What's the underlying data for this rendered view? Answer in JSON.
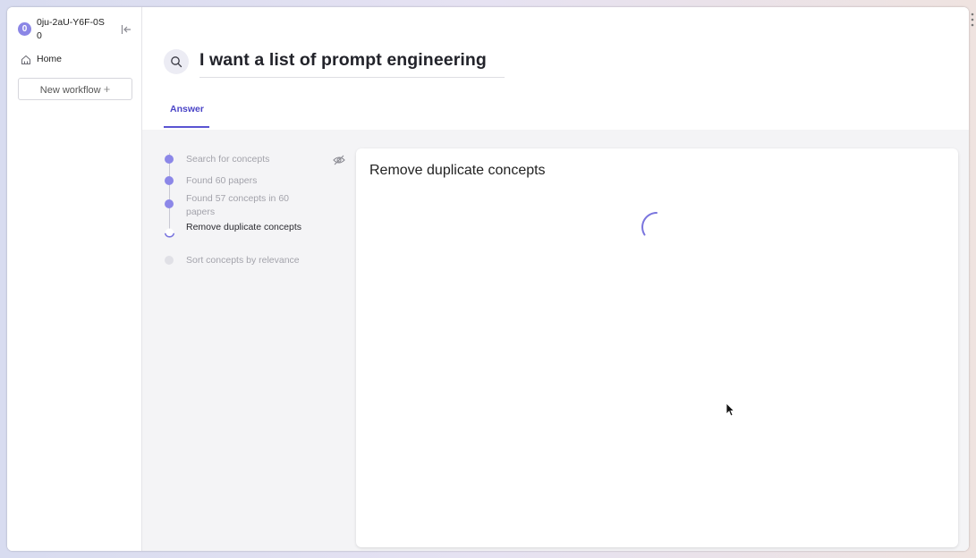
{
  "sidebar": {
    "workspace_initial": "0",
    "workspace_name": "0ju-2aU-Y6F-0S0",
    "collapse_icon": "collapse-left-icon",
    "home_label": "Home",
    "home_icon": "home-icon",
    "new_workflow_label": "New workflow",
    "new_workflow_icon": "+"
  },
  "header": {
    "search_icon": "search-icon",
    "query": "I want a list of prompt engineering"
  },
  "tabs": [
    {
      "label": "Answer",
      "active": true
    }
  ],
  "steps": [
    {
      "label": "Search for concepts",
      "status": "done"
    },
    {
      "label": "Found 60 papers",
      "status": "done"
    },
    {
      "label": "Found 57 concepts in 60 papers",
      "status": "done"
    },
    {
      "label": "Remove duplicate concepts",
      "status": "in-progress"
    },
    {
      "label": "Sort concepts by relevance",
      "status": "pending"
    }
  ],
  "panel": {
    "title": "Remove duplicate concepts",
    "loading": true
  },
  "colors": {
    "accent": "#5a54d2",
    "step_done": "#8c87e8",
    "step_pending": "#e0e0e6",
    "spinner": "#7a75de"
  }
}
